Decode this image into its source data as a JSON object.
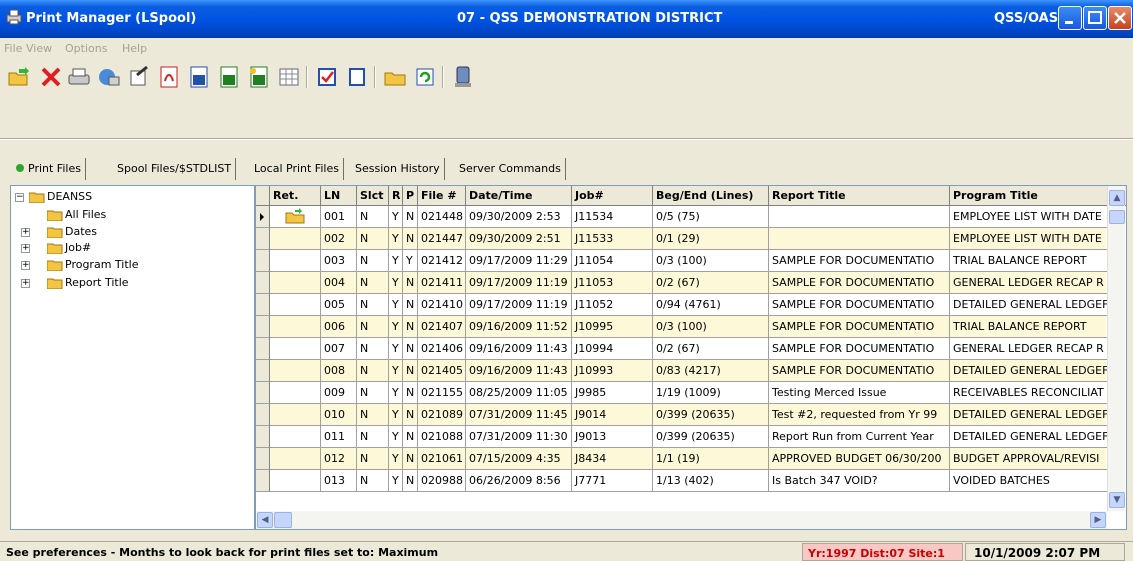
{
  "window": {
    "title": "Print Manager (LSpool)",
    "district": "07 - QSS DEMONSTRATION DISTRICT",
    "product": "QSS/OASIS"
  },
  "menu": [
    "File",
    "View",
    "Options",
    "Help"
  ],
  "toolbar": [
    {
      "icon": "open-folder-icon"
    },
    {
      "icon": "delete-icon"
    },
    {
      "icon": "printer-icon"
    },
    {
      "icon": "print-server-icon"
    },
    {
      "icon": "properties-icon"
    },
    {
      "icon": "pdf-icon"
    },
    {
      "icon": "word-icon"
    },
    {
      "icon": "excel-icon"
    },
    {
      "icon": "excel-export-icon"
    },
    {
      "icon": "grid-icon"
    },
    {
      "icon": "select-all-icon"
    },
    {
      "icon": "deselect-icon"
    },
    {
      "icon": "browse-folder-icon"
    },
    {
      "icon": "refresh-icon"
    },
    {
      "icon": "computer-icon"
    }
  ],
  "tabs": [
    {
      "label": "Print Files",
      "active": true
    },
    {
      "label": "Spool Files/$STDLIST"
    },
    {
      "label": "Local Print Files"
    },
    {
      "label": "Session History"
    },
    {
      "label": "Server Commands"
    }
  ],
  "tree": {
    "root": "DEANSS",
    "children": [
      "All Files",
      "Dates",
      "Job#",
      "Program Title",
      "Report Title"
    ]
  },
  "grid": {
    "columns": [
      "Ret.",
      "LN",
      "Slct",
      "R",
      "P",
      "File #",
      "Date/Time",
      "Job#",
      "Beg/End (Lines)",
      "Report Title",
      "Program Title"
    ],
    "rows": [
      [
        "",
        "001",
        "N",
        "Y",
        "N",
        "021448",
        "09/30/2009 2:53",
        "J11534",
        "0/5 (75)",
        "",
        "EMPLOYEE LIST WITH DATE"
      ],
      [
        "",
        "002",
        "N",
        "Y",
        "N",
        "021447",
        "09/30/2009 2:51",
        "J11533",
        "0/1 (29)",
        "",
        "EMPLOYEE LIST WITH DATE"
      ],
      [
        "",
        "003",
        "N",
        "Y",
        "Y",
        "021412",
        "09/17/2009 11:29",
        "J11054",
        "0/3 (100)",
        "SAMPLE FOR DOCUMENTATIO",
        "TRIAL BALANCE REPORT"
      ],
      [
        "",
        "004",
        "N",
        "Y",
        "N",
        "021411",
        "09/17/2009 11:19",
        "J11053",
        "0/2 (67)",
        "SAMPLE FOR DOCUMENTATIO",
        "GENERAL LEDGER RECAP R"
      ],
      [
        "",
        "005",
        "N",
        "Y",
        "N",
        "021410",
        "09/17/2009 11:19",
        "J11052",
        "0/94 (4761)",
        "SAMPLE FOR DOCUMENTATIO",
        "DETAILED GENERAL LEDGEF"
      ],
      [
        "",
        "006",
        "N",
        "Y",
        "N",
        "021407",
        "09/16/2009 11:52",
        "J10995",
        "0/3 (100)",
        "SAMPLE FOR DOCUMENTATIO",
        "TRIAL BALANCE REPORT"
      ],
      [
        "",
        "007",
        "N",
        "Y",
        "N",
        "021406",
        "09/16/2009 11:43",
        "J10994",
        "0/2 (67)",
        "SAMPLE FOR DOCUMENTATIO",
        "GENERAL LEDGER RECAP R"
      ],
      [
        "",
        "008",
        "N",
        "Y",
        "N",
        "021405",
        "09/16/2009 11:43",
        "J10993",
        "0/83 (4217)",
        "SAMPLE FOR DOCUMENTATIO",
        "DETAILED GENERAL LEDGEF"
      ],
      [
        "",
        "009",
        "N",
        "Y",
        "N",
        "021155",
        "08/25/2009 11:05",
        "J9985",
        "1/19 (1009)",
        "Testing Merced Issue",
        "RECEIVABLES RECONCILIAT"
      ],
      [
        "",
        "010",
        "N",
        "Y",
        "N",
        "021089",
        "07/31/2009 11:45",
        "J9014",
        "0/399 (20635)",
        "Test #2, requested from Yr 99",
        "DETAILED GENERAL LEDGEF"
      ],
      [
        "",
        "011",
        "N",
        "Y",
        "N",
        "021088",
        "07/31/2009 11:30",
        "J9013",
        "0/399 (20635)",
        "Report Run from Current Year",
        "DETAILED GENERAL LEDGEF"
      ],
      [
        "",
        "012",
        "N",
        "Y",
        "N",
        "021061",
        "07/15/2009 4:35",
        "J8434",
        "1/1 (19)",
        "APPROVED BUDGET 06/30/200",
        "BUDGET APPROVAL/REVISI"
      ],
      [
        "",
        "013",
        "N",
        "Y",
        "N",
        "020988",
        "06/26/2009 8:56",
        "J7771",
        "1/13 (402)",
        "Is Batch 347 VOID?",
        "VOIDED BATCHES"
      ]
    ]
  },
  "status": {
    "message": "See preferences - Months to look back for print files set to: Maximum",
    "context": "Yr:1997 Dist:07 Site:1",
    "datetime": "10/1/2009  2:07 PM"
  },
  "colors": {
    "title_bar": "#0054e3",
    "alt_row": "#fdf8d8",
    "status_context_bg": "#f8c8c4"
  }
}
